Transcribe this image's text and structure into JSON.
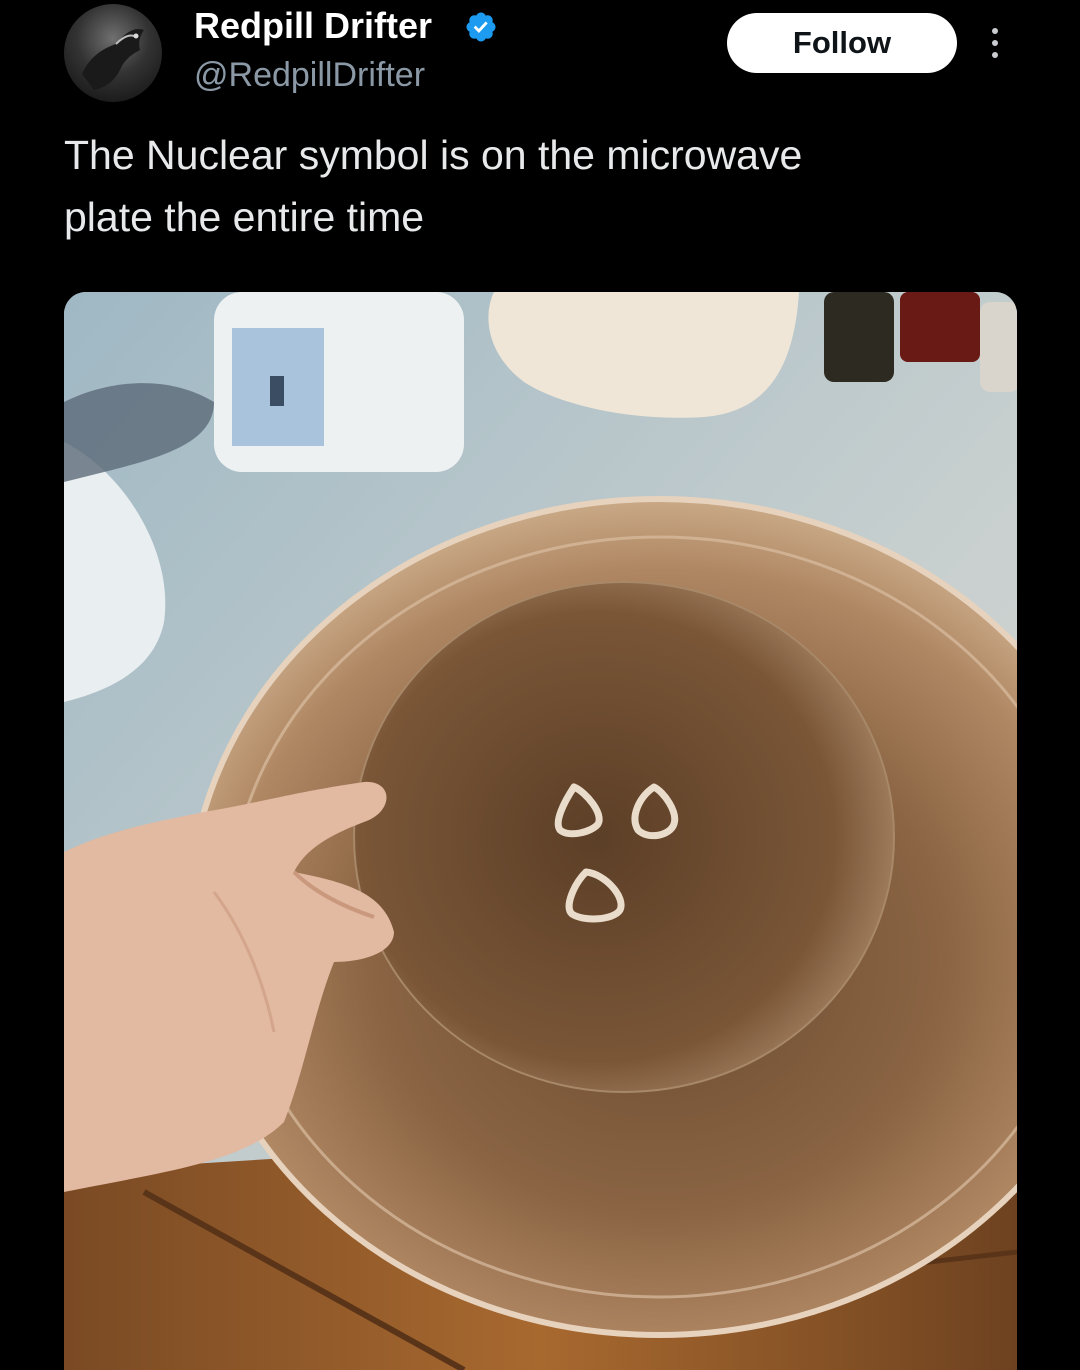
{
  "post": {
    "author": {
      "display_name": "Redpill Drifter",
      "handle": "@RedpillDrifter",
      "verified": true,
      "verified_color": "#1d9bf0"
    },
    "follow_label": "Follow",
    "more_icon": "more-vertical-icon",
    "text_line1": "The Nuclear symbol is on the microwave",
    "text_line2": "plate the entire time"
  },
  "theme": {
    "background": "#000000",
    "text": "#e7e9ea",
    "secondary_text": "#8b98a5",
    "button_bg": "#ffffff"
  }
}
